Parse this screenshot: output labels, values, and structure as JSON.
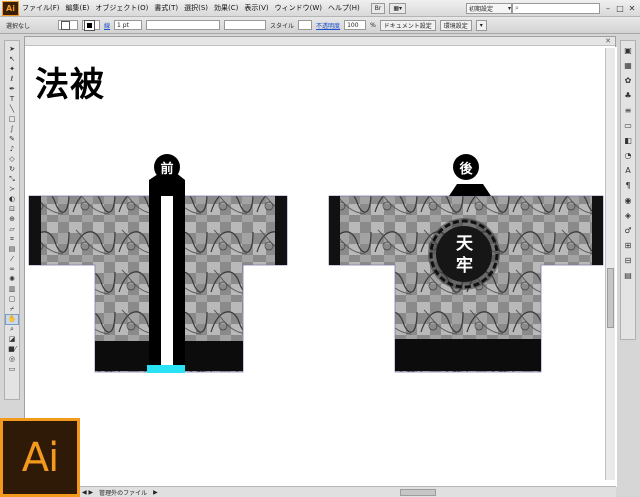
{
  "app": {
    "logo_small": "Ai",
    "logo_big": "Ai"
  },
  "menu": {
    "items": [
      "ファイル(F)",
      "編集(E)",
      "オブジェクト(O)",
      "書式(T)",
      "選択(S)",
      "効果(C)",
      "表示(V)",
      "ウィンドウ(W)",
      "ヘルプ(H)"
    ],
    "workspace": "初期設定",
    "search_placeholder": "",
    "win_min": "–",
    "win_max": "□",
    "win_close": "✕"
  },
  "controlbar": {
    "selection": "選択なし",
    "stroke_label": "線",
    "stroke_weight": "1 pt",
    "style_label": "スタイル",
    "opacity_label": "不透明度",
    "opacity_value": "100",
    "opacity_unit": "%",
    "doc_setup": "ドキュメント設定",
    "prefs": "環境設定"
  },
  "document": {
    "title": "法被",
    "front_badge": "前",
    "back_badge": "後",
    "crest_text_1": "天",
    "crest_text_2": "牢"
  },
  "statusbar": {
    "status_text": "管理外のファイル"
  },
  "colors": {
    "accent": "#f39a1e",
    "cyan_band": "#29e2f3"
  },
  "icons": {
    "tools": [
      "selection-tool",
      "direct-selection-tool",
      "magic-wand-tool",
      "lasso-tool",
      "pen-tool",
      "type-tool",
      "line-tool",
      "rectangle-tool",
      "paintbrush-tool",
      "pencil-tool",
      "blob-brush-tool",
      "eraser-tool",
      "rotate-tool",
      "scale-tool",
      "width-tool",
      "warp-tool",
      "free-transform-tool",
      "shape-builder-tool",
      "perspective-grid-tool",
      "mesh-tool",
      "gradient-tool",
      "eyedropper-tool",
      "blend-tool",
      "symbol-sprayer-tool",
      "column-graph-tool",
      "artboard-tool",
      "slice-tool",
      "hand-tool",
      "zoom-tool"
    ],
    "dock": [
      "color-icon",
      "color-guide-icon",
      "swatches-icon",
      "brushes-icon",
      "symbols-icon",
      "stroke-icon",
      "gradient-icon",
      "transparency-icon",
      "appearance-icon",
      "graphic-styles-icon",
      "layers-icon",
      "artboards-icon",
      "character-icon",
      "paragraph-icon",
      "align-icon",
      "transform-icon"
    ]
  }
}
